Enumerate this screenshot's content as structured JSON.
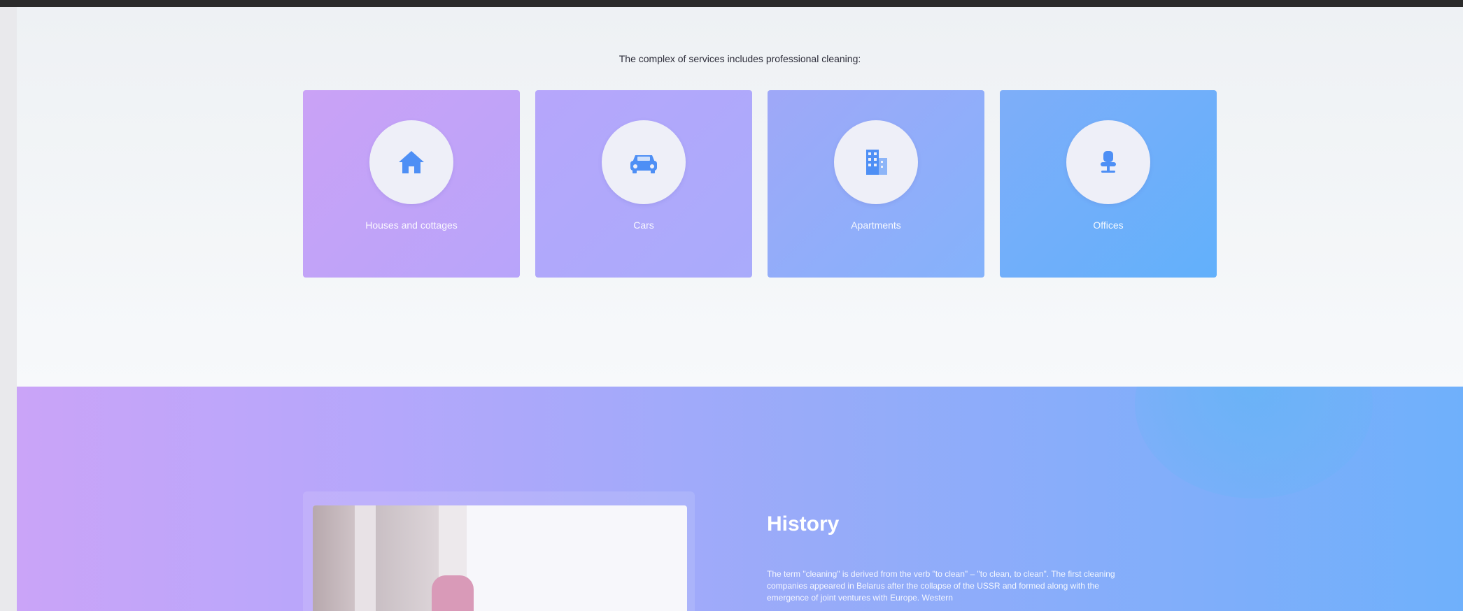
{
  "services": {
    "heading": "The complex of services includes professional cleaning:",
    "cards": [
      {
        "label": "Houses and cottages",
        "icon": "house-icon"
      },
      {
        "label": "Cars",
        "icon": "car-icon"
      },
      {
        "label": "Apartments",
        "icon": "building-icon"
      },
      {
        "label": "Offices",
        "icon": "office-chair-icon"
      }
    ]
  },
  "history": {
    "title": "History",
    "text": "The term \"cleaning\" is derived from the verb \"to clean\" – \"to clean, to clean\". The first cleaning companies appeared in Belarus after the collapse of the USSR and formed along with the emergence of joint ventures with Europe. Western"
  },
  "colors": {
    "accent_purple": "#caa2f6",
    "accent_blue": "#62b0fb",
    "icon_blue": "#4e8ff5"
  }
}
